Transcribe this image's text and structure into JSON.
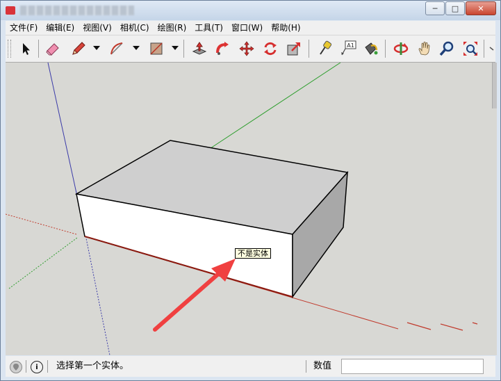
{
  "window": {
    "title": "▒▒▒▒ ▒▒▒▒▒▒▒▒▒ ▒▒▒▒",
    "buttons": {
      "minimize": "─",
      "maximize": "□",
      "close": "✕"
    }
  },
  "menubar": {
    "items": [
      {
        "label": "文件(F)"
      },
      {
        "label": "编辑(E)"
      },
      {
        "label": "视图(V)"
      },
      {
        "label": "相机(C)"
      },
      {
        "label": "绘图(R)"
      },
      {
        "label": "工具(T)"
      },
      {
        "label": "窗口(W)"
      },
      {
        "label": "帮助(H)"
      }
    ]
  },
  "toolbar": {
    "tools": [
      {
        "icon": "select-arrow-icon"
      },
      {
        "icon": "eraser-icon"
      },
      {
        "icon": "pencil-line-icon",
        "has_dropdown": true
      },
      {
        "icon": "arc-icon",
        "has_dropdown": true
      },
      {
        "icon": "rectangle-icon",
        "has_dropdown": true
      },
      {
        "icon": "push-pull-icon"
      },
      {
        "icon": "follow-me-icon"
      },
      {
        "icon": "move-icon"
      },
      {
        "icon": "rotate-icon"
      },
      {
        "icon": "scale-icon"
      },
      {
        "icon": "tape-measure-icon"
      },
      {
        "icon": "text-label-icon"
      },
      {
        "icon": "paint-bucket-icon"
      },
      {
        "icon": "orbit-icon"
      },
      {
        "icon": "pan-hand-icon"
      },
      {
        "icon": "zoom-icon"
      },
      {
        "icon": "zoom-extents-icon"
      }
    ],
    "text_tool_label": "A1"
  },
  "viewport": {
    "tooltip": "不是实体",
    "colors": {
      "background": "#d8d8d4",
      "axis_red": "#c0392b",
      "axis_green": "#2e9e2e",
      "axis_blue": "#3a3aa8",
      "box_top": "#cfcfcf",
      "box_front": "#ffffff",
      "box_side": "#a8a8a8",
      "annotation_arrow": "#f04040"
    }
  },
  "statusbar": {
    "geo_icon": "geolocation-icon",
    "info_icon": "info-icon",
    "info_glyph": "i",
    "status_text": "选择第一个实体。",
    "measurements_label": "数值",
    "measurements_value": ""
  }
}
